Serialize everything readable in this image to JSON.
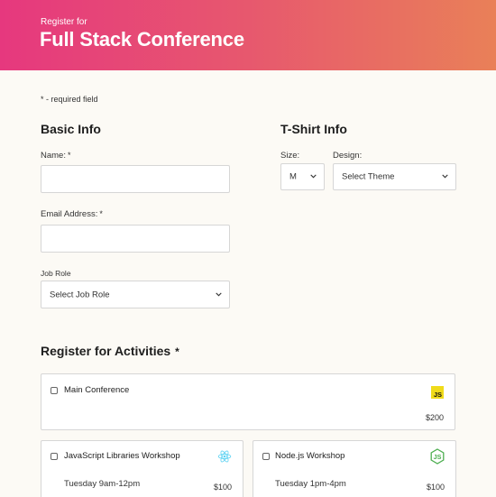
{
  "header": {
    "subtitle": "Register for",
    "title": "Full Stack Conference"
  },
  "form": {
    "required_note": "* - required field",
    "basic_info": {
      "heading": "Basic Info",
      "name_label": "Name:",
      "name_required": "*",
      "name_value": "",
      "email_label": "Email Address:",
      "email_required": "*",
      "email_value": "",
      "job_role_label": "Job Role",
      "job_role_selected": "Select Job Role"
    },
    "tshirt_info": {
      "heading": "T-Shirt Info",
      "size_label": "Size:",
      "size_selected": "M",
      "design_label": "Design:",
      "design_selected": "Select Theme"
    },
    "activities": {
      "heading": "Register for Activities",
      "required": "*",
      "items": [
        {
          "name": "Main Conference",
          "time": "",
          "price": "$200",
          "icon": "javascript-icon",
          "icon_text": "JS"
        },
        {
          "name": "JavaScript Libraries Workshop",
          "time": "Tuesday 9am-12pm",
          "price": "$100",
          "icon": "react-icon"
        },
        {
          "name": "Node.js Workshop",
          "time": "Tuesday 1pm-4pm",
          "price": "$100",
          "icon": "nodejs-icon"
        }
      ]
    }
  },
  "colors": {
    "header_gradient_start": "#e6387e",
    "header_gradient_end": "#e98058",
    "background": "#fcfaf5",
    "js_yellow": "#f0db1a",
    "react_cyan": "#5fd3f3",
    "node_green": "#4cae4f"
  }
}
